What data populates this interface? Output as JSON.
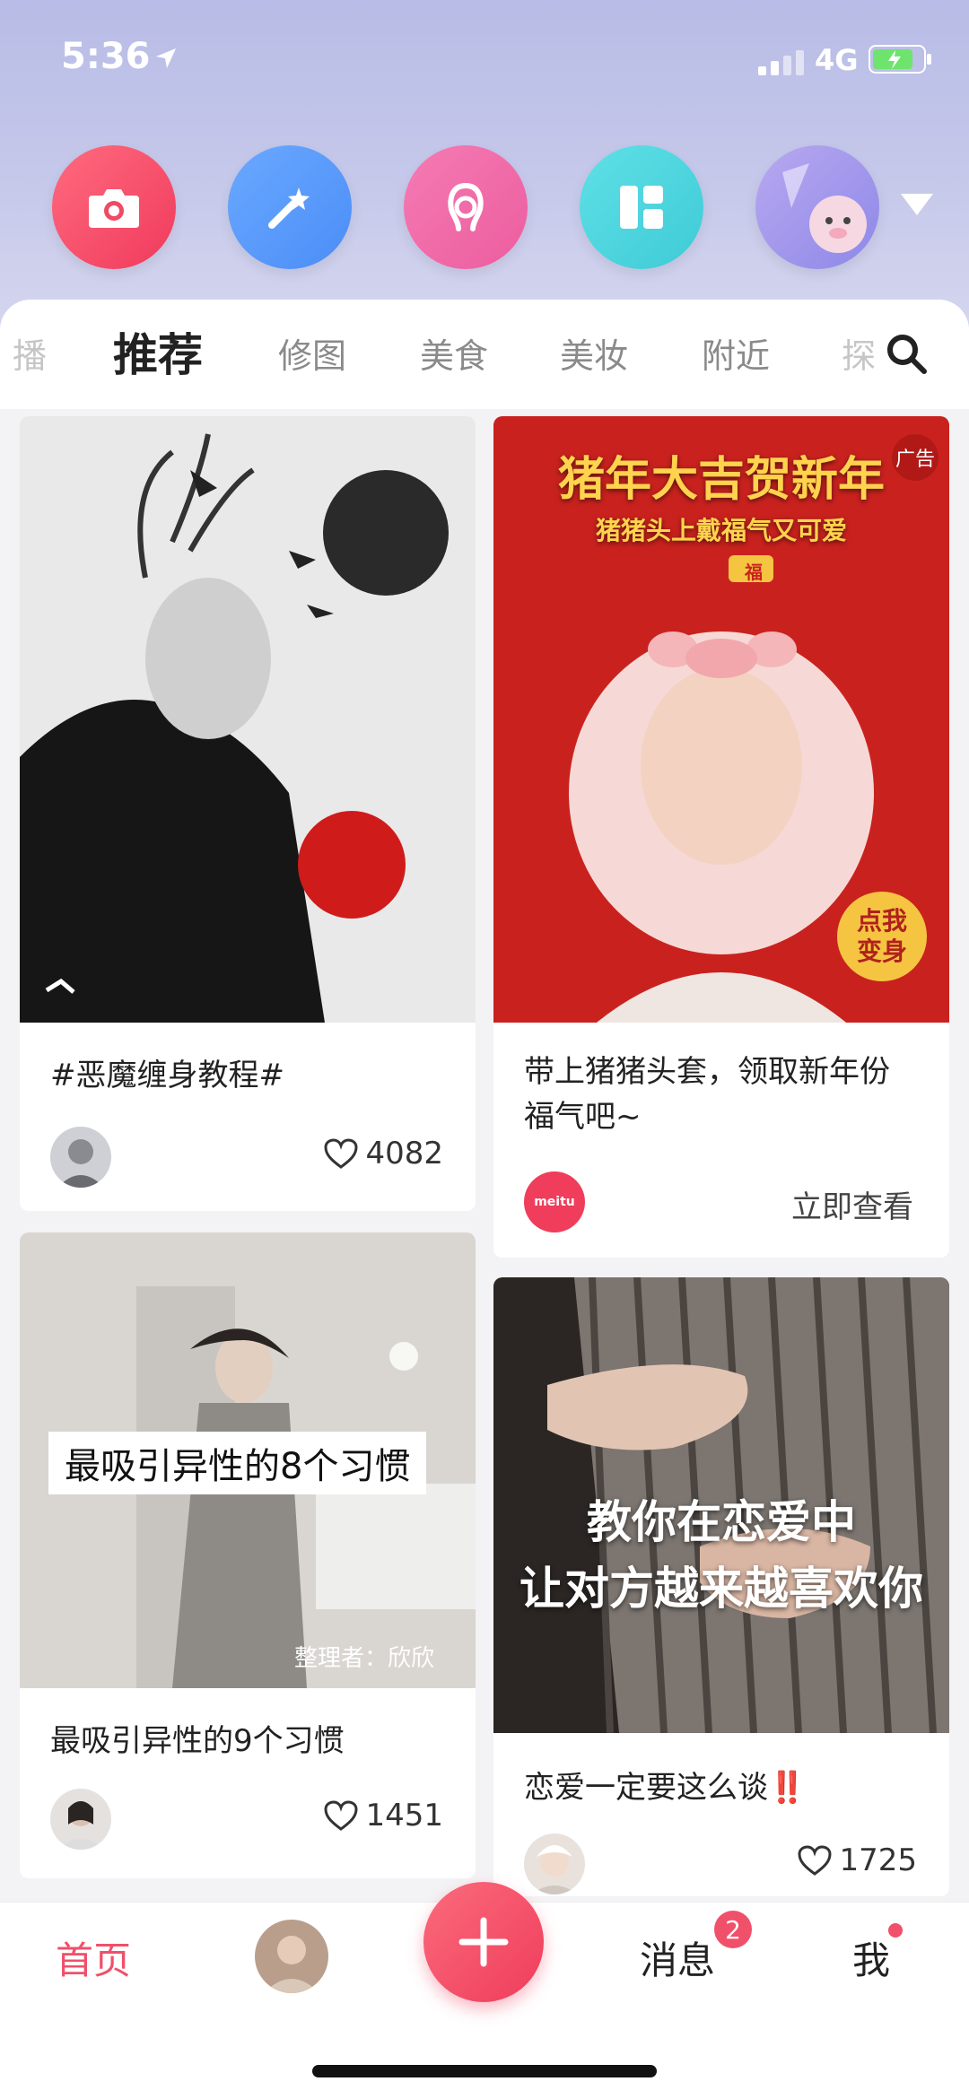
{
  "status": {
    "time": "5:36",
    "network": "4G"
  },
  "quick_actions": [
    "camera-icon",
    "magic-wand-icon",
    "beauty-icon",
    "layout-icon",
    "profile-avatar"
  ],
  "tabs": {
    "items": [
      "播",
      "推荐",
      "修图",
      "美食",
      "美妆",
      "附近",
      "探"
    ],
    "active": "推荐"
  },
  "feed": [
    {
      "title": "#恶魔缠身教程#",
      "likes": "4082"
    },
    {
      "title": "带上猪猪头套，领取新年份福气吧~",
      "cta": "立即查看",
      "ad_label": "广告",
      "banner_title": "猪年大吉贺新年",
      "banner_sub": "猪猪头上戴福气又可爱",
      "banner_badge": "点我变身",
      "fu": "福",
      "brand": "meitu"
    },
    {
      "title": "最吸引异性的9个习惯",
      "likes": "1451",
      "overlay": "最吸引异性的8个习惯",
      "tag": "整理者：欣欣"
    },
    {
      "title": "恋爱一定要这么谈‼️",
      "likes": "1725",
      "overlay_line1": "教你在恋爱中",
      "overlay_line2": "让对方越来越喜欢你"
    }
  ],
  "bottom_nav": {
    "home": "首页",
    "messages": "消息",
    "message_badge": "2",
    "me": "我"
  },
  "colors": {
    "accent": "#f0506a",
    "header_bg": "#c6c9ea"
  }
}
